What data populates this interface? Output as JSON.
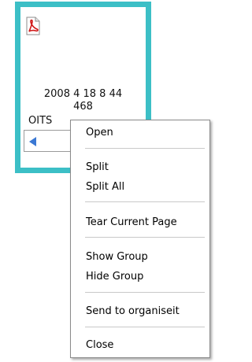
{
  "thumbnail": {
    "icon": "pdf-icon",
    "line1": "2008 4 18 8 44",
    "line2": "468",
    "line3": "OITS",
    "border_color": "#3cbfc6",
    "arrow_color": "#3a78d4"
  },
  "context_menu": {
    "items": [
      {
        "label": "Open"
      },
      {
        "label": "Split"
      },
      {
        "label": "Split All"
      },
      {
        "label": "Tear Current Page"
      },
      {
        "label": "Show Group"
      },
      {
        "label": "Hide Group"
      },
      {
        "label": "Send to organiseit"
      },
      {
        "label": "Close"
      }
    ]
  }
}
